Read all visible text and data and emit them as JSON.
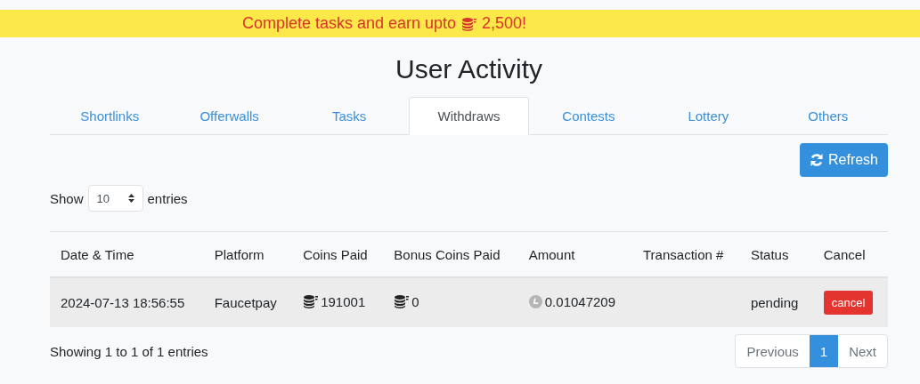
{
  "banner": {
    "text": "Complete tasks and earn upto",
    "amount": "2,500!"
  },
  "title": "User Activity",
  "tabs": [
    {
      "label": "Shortlinks",
      "selected": false
    },
    {
      "label": "Offerwalls",
      "selected": false
    },
    {
      "label": "Tasks",
      "selected": false
    },
    {
      "label": "Withdraws",
      "selected": true
    },
    {
      "label": "Contests",
      "selected": false
    },
    {
      "label": "Lottery",
      "selected": false
    },
    {
      "label": "Others",
      "selected": false
    }
  ],
  "refresh_button": "Refresh",
  "length_menu": {
    "before": "Show",
    "value": "10",
    "after": "entries"
  },
  "table": {
    "columns": [
      "Date & Time",
      "Platform",
      "Coins Paid",
      "Bonus Coins Paid",
      "Amount",
      "Transaction #",
      "Status",
      "Cancel"
    ],
    "rows": [
      {
        "cells": [
          {
            "kind": "text",
            "text": "2024-07-13 18:56:55"
          },
          {
            "kind": "text",
            "text": "Faucetpay"
          },
          {
            "kind": "coins",
            "text": "191001"
          },
          {
            "kind": "coins",
            "text": "0"
          },
          {
            "kind": "crypto",
            "text": "0.01047209"
          },
          {
            "kind": "empty"
          },
          {
            "kind": "text",
            "text": "pending"
          },
          {
            "kind": "button",
            "text": "cancel"
          }
        ]
      }
    ]
  },
  "info": "Showing 1 to 1 of 1 entries",
  "pagination": [
    {
      "label": "Previous",
      "selected": false
    },
    {
      "label": "1",
      "selected": true
    },
    {
      "label": "Next",
      "selected": false
    }
  ]
}
